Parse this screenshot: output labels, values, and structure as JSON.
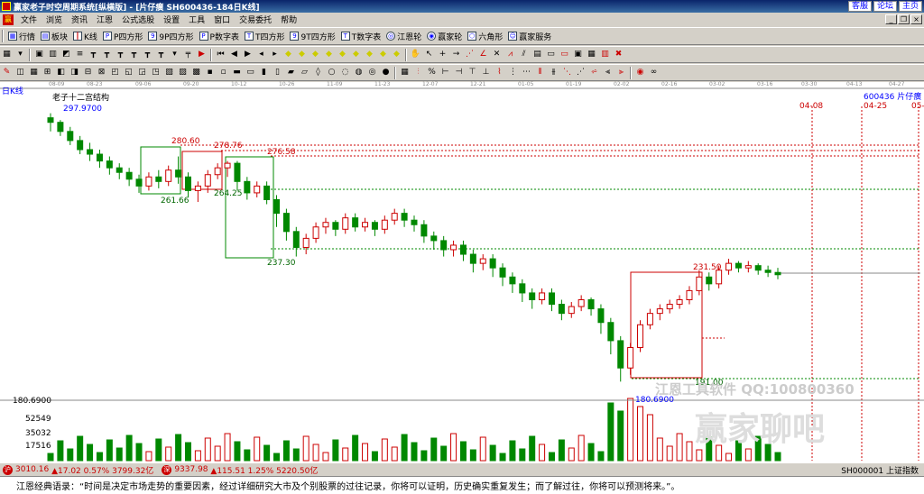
{
  "window": {
    "title": "赢家老子时空周期系统[纵横版] - [片仔癀  SH600436-184日K线]",
    "links": [
      "客服",
      "论坛",
      "主页"
    ]
  },
  "menu": [
    "文件",
    "浏览",
    "资讯",
    "江恩",
    "公式选股",
    "设置",
    "工具",
    "窗口",
    "交易委托",
    "帮助"
  ],
  "toolbar1": [
    {
      "label": "行情",
      "icon": "grid-icon"
    },
    {
      "label": "板块",
      "icon": "blocks-icon"
    },
    {
      "label": "K线",
      "icon": "candle-icon"
    },
    {
      "label": "P四方形",
      "icon": "p-square-icon"
    },
    {
      "label": "9P四方形",
      "icon": "9p-square-icon"
    },
    {
      "label": "P数字表",
      "icon": "p-table-icon"
    },
    {
      "label": "T四方形",
      "icon": "t-square-icon"
    },
    {
      "label": "9T四方形",
      "icon": "9t-square-icon"
    },
    {
      "label": "T数字表",
      "icon": "t-table-icon"
    },
    {
      "label": "江恩轮",
      "icon": "gann-wheel-icon"
    },
    {
      "label": "赢家轮",
      "icon": "winner-wheel-icon"
    },
    {
      "label": "六角形",
      "icon": "hexagon-icon"
    },
    {
      "label": "赢家服务",
      "icon": "service-icon"
    }
  ],
  "chart": {
    "period_label": "日K线",
    "structure_label": "老子十二宫结构",
    "stock_label": "600436  片仔癀",
    "top_dates": [
      "08-09",
      "08-23",
      "09-06",
      "09-20",
      "10-12",
      "10-26",
      "11-09",
      "11-23",
      "12-07",
      "12-21",
      "01-05",
      "01-19",
      "02-02",
      "02-16",
      "03-02",
      "03-16",
      "03-30",
      "04-13",
      "04-27"
    ],
    "right_dates": [
      "04-08",
      "04-25",
      "05-"
    ],
    "price_labels": {
      "high": "297.9700",
      "p1": "280.60",
      "p2": "278.76",
      "p3": "276.58",
      "p4": "261.66",
      "p5": "264.25",
      "p6": "237.30",
      "p7": "231.50",
      "p8": "191.00",
      "low": "180.6900"
    },
    "axis_labels": [
      "180.6900",
      "52549",
      "35032",
      "17516"
    ],
    "watermark": "江恩工具软件  QQ:100800360",
    "watermark2": "赢家聊吧"
  },
  "chart_data": {
    "type": "candlestick",
    "title": "老子十二宫结构",
    "y_range": [
      175,
      305
    ],
    "candles": [
      [
        298,
        296,
        292,
        300
      ],
      [
        296,
        292,
        290,
        297
      ],
      [
        292,
        288,
        286,
        294
      ],
      [
        288,
        284,
        282,
        290
      ],
      [
        284,
        282,
        279,
        287
      ],
      [
        282,
        279,
        276,
        284
      ],
      [
        279,
        276,
        273,
        281
      ],
      [
        276,
        274,
        271,
        278
      ],
      [
        274,
        271,
        268,
        276
      ],
      [
        271,
        268,
        265,
        273
      ],
      [
        268,
        272,
        266,
        274
      ],
      [
        272,
        270,
        267,
        275
      ],
      [
        270,
        275,
        268,
        277
      ],
      [
        275,
        272,
        269,
        281
      ],
      [
        272,
        266,
        263,
        274
      ],
      [
        266,
        268,
        261,
        270
      ],
      [
        268,
        273,
        265,
        275
      ],
      [
        273,
        276,
        271,
        278
      ],
      [
        276,
        278,
        272,
        279
      ],
      [
        278,
        270,
        266,
        279
      ],
      [
        270,
        265,
        262,
        272
      ],
      [
        265,
        268,
        263,
        270
      ],
      [
        268,
        262,
        260,
        270
      ],
      [
        262,
        256,
        250,
        264
      ],
      [
        256,
        248,
        244,
        258
      ],
      [
        248,
        241,
        237,
        250
      ],
      [
        241,
        245,
        238,
        247
      ],
      [
        245,
        250,
        243,
        252
      ],
      [
        250,
        252,
        247,
        254
      ],
      [
        252,
        249,
        246,
        253
      ],
      [
        249,
        254,
        247,
        256
      ],
      [
        254,
        250,
        248,
        256
      ],
      [
        250,
        252,
        248,
        254
      ],
      [
        252,
        249,
        246,
        253
      ],
      [
        249,
        253,
        247,
        255
      ],
      [
        253,
        256,
        251,
        258
      ],
      [
        256,
        253,
        250,
        258
      ],
      [
        253,
        251,
        248,
        255
      ],
      [
        251,
        246,
        243,
        253
      ],
      [
        246,
        244,
        240,
        248
      ],
      [
        244,
        240,
        237,
        246
      ],
      [
        240,
        242,
        237,
        244
      ],
      [
        242,
        238,
        235,
        244
      ],
      [
        238,
        234,
        230,
        240
      ],
      [
        234,
        236,
        231,
        238
      ],
      [
        236,
        232,
        228,
        238
      ],
      [
        232,
        228,
        224,
        234
      ],
      [
        228,
        225,
        221,
        230
      ],
      [
        225,
        221,
        217,
        227
      ],
      [
        221,
        218,
        214,
        223
      ],
      [
        218,
        221,
        216,
        223
      ],
      [
        221,
        216,
        213,
        223
      ],
      [
        216,
        212,
        209,
        218
      ],
      [
        212,
        215,
        210,
        217
      ],
      [
        215,
        218,
        213,
        220
      ],
      [
        218,
        214,
        211,
        219
      ],
      [
        214,
        208,
        203,
        216
      ],
      [
        208,
        200,
        194,
        210
      ],
      [
        200,
        188,
        182,
        202
      ],
      [
        188,
        197,
        185,
        199
      ],
      [
        197,
        207,
        195,
        209
      ],
      [
        207,
        212,
        205,
        214
      ],
      [
        212,
        214,
        209,
        216
      ],
      [
        214,
        216,
        212,
        218
      ],
      [
        216,
        218,
        214,
        220
      ],
      [
        218,
        222,
        216,
        224
      ],
      [
        222,
        228,
        220,
        231
      ],
      [
        228,
        225,
        222,
        230
      ],
      [
        225,
        231,
        223,
        233
      ],
      [
        231,
        234,
        229,
        236
      ],
      [
        234,
        232,
        230,
        235
      ],
      [
        232,
        233,
        230,
        235
      ],
      [
        233,
        231,
        229,
        234
      ],
      [
        231,
        230,
        228,
        233
      ],
      [
        230,
        229,
        227,
        232
      ]
    ]
  },
  "status": {
    "sh_index": "3010.16",
    "sh_change": "▲17.02 0.57% 3799.32亿",
    "sz_index": "9337.98",
    "sz_change": "▲115.51 1.25% 5220.50亿",
    "code": "SH000001 上证指数"
  },
  "quote": "江恩经典语录：“时间是决定市场走势的重要因素，经过详细研究大市及个别股票的过往记录，你将可以证明，历史确实重复发生；而了解过往，你将可以预测将来。”。"
}
